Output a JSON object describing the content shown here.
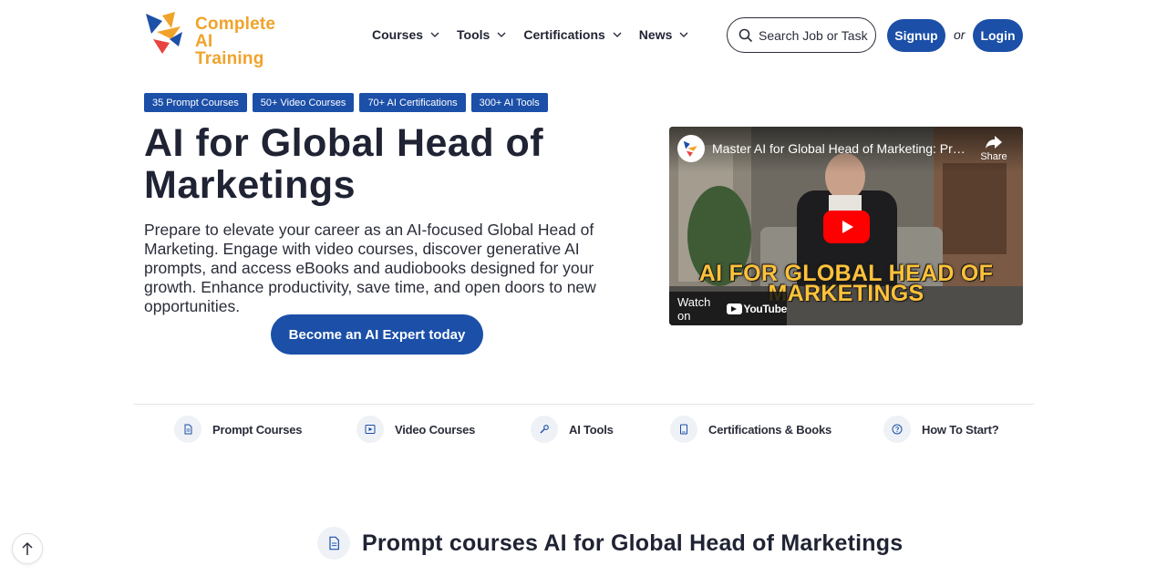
{
  "header": {
    "logo": {
      "line1": "Complete",
      "line2": "AI Training"
    },
    "nav": [
      {
        "label": "Courses"
      },
      {
        "label": "Tools"
      },
      {
        "label": "Certifications"
      },
      {
        "label": "News"
      }
    ],
    "search": {
      "placeholder": "Search Job or Tasks"
    },
    "signup_label": "Signup",
    "or_label": "or",
    "login_label": "Login"
  },
  "badges": [
    "35 Prompt Courses",
    "50+ Video Courses",
    "70+ AI Certifications",
    "300+ AI Tools"
  ],
  "hero": {
    "title": "AI for Global Head of Marketings",
    "description": "Prepare to elevate your career as an AI-focused Global Head of Marketing. Engage with video courses, discover generative AI prompts, and access eBooks and audiobooks designed for your growth. Enhance productivity, save time, and open doors to new opportunities.",
    "cta_label": "Become an AI Expert today"
  },
  "video": {
    "title": "Master AI for Global Head of Marketing: Pro...",
    "share_label": "Share",
    "overlay_line1": "AI FOR GLOBAL HEAD OF",
    "overlay_line2": "MARKETINGS",
    "watch_on_label": "Watch on",
    "youtube_label": "YouTube"
  },
  "sections": [
    {
      "label": "Prompt Courses",
      "icon": "document-icon"
    },
    {
      "label": "Video Courses",
      "icon": "play-icon"
    },
    {
      "label": "AI Tools",
      "icon": "wrench-icon"
    },
    {
      "label": "Certifications & Books",
      "icon": "book-icon"
    },
    {
      "label": "How To Start?",
      "icon": "question-icon"
    }
  ],
  "bottom_heading": "Prompt courses AI for Global Head of Marketings",
  "colors": {
    "primary": "#1b4fa8",
    "logo_orange": "#f0a32b",
    "youtube_red": "#ff0000"
  }
}
